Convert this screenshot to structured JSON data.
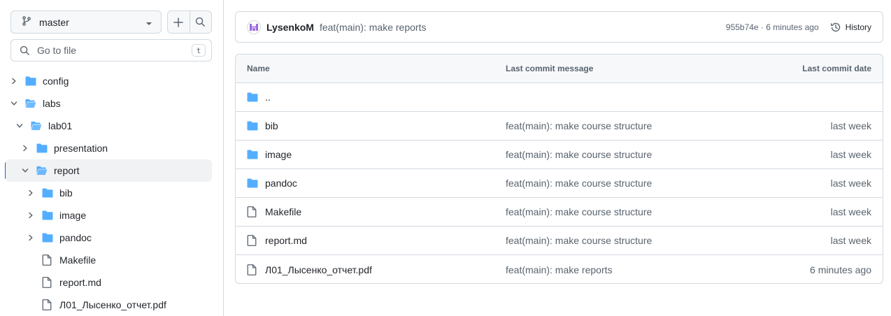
{
  "sidebar": {
    "branch": "master",
    "search_placeholder": "Go to file",
    "search_shortcut": "t",
    "tree": [
      {
        "label": "config",
        "type": "folder",
        "expanded": false
      },
      {
        "label": "labs",
        "type": "folder",
        "expanded": true
      },
      {
        "label": "lab01",
        "type": "folder",
        "expanded": true
      },
      {
        "label": "presentation",
        "type": "folder",
        "expanded": false
      },
      {
        "label": "report",
        "type": "folder",
        "expanded": true,
        "selected": true
      },
      {
        "label": "bib",
        "type": "folder",
        "expanded": false
      },
      {
        "label": "image",
        "type": "folder",
        "expanded": false
      },
      {
        "label": "pandoc",
        "type": "folder",
        "expanded": false
      },
      {
        "label": "Makefile",
        "type": "file"
      },
      {
        "label": "report.md",
        "type": "file"
      },
      {
        "label": "Л01_Лысенко_отчет.pdf",
        "type": "file"
      }
    ]
  },
  "commit": {
    "author": "LysenkoM",
    "message": "feat(main): make reports",
    "meta": "955b74e · 6 minutes ago",
    "history_label": "History"
  },
  "table": {
    "headers": {
      "name": "Name",
      "message": "Last commit message",
      "date": "Last commit date"
    },
    "rows": [
      {
        "name": "..",
        "type": "folder",
        "message": "",
        "date": ""
      },
      {
        "name": "bib",
        "type": "folder",
        "message": "feat(main): make course structure",
        "date": "last week"
      },
      {
        "name": "image",
        "type": "folder",
        "message": "feat(main): make course structure",
        "date": "last week"
      },
      {
        "name": "pandoc",
        "type": "folder",
        "message": "feat(main): make course structure",
        "date": "last week"
      },
      {
        "name": "Makefile",
        "type": "file",
        "message": "feat(main): make course structure",
        "date": "last week"
      },
      {
        "name": "report.md",
        "type": "file",
        "message": "feat(main): make course structure",
        "date": "last week"
      },
      {
        "name": "Л01_Лысенко_отчет.pdf",
        "type": "file",
        "message": "feat(main): make reports",
        "date": "6 minutes ago"
      }
    ]
  },
  "colors": {
    "folder": "#54aeff",
    "accent": "#0969da",
    "border": "#d1d9e0",
    "muted": "#59636e"
  }
}
